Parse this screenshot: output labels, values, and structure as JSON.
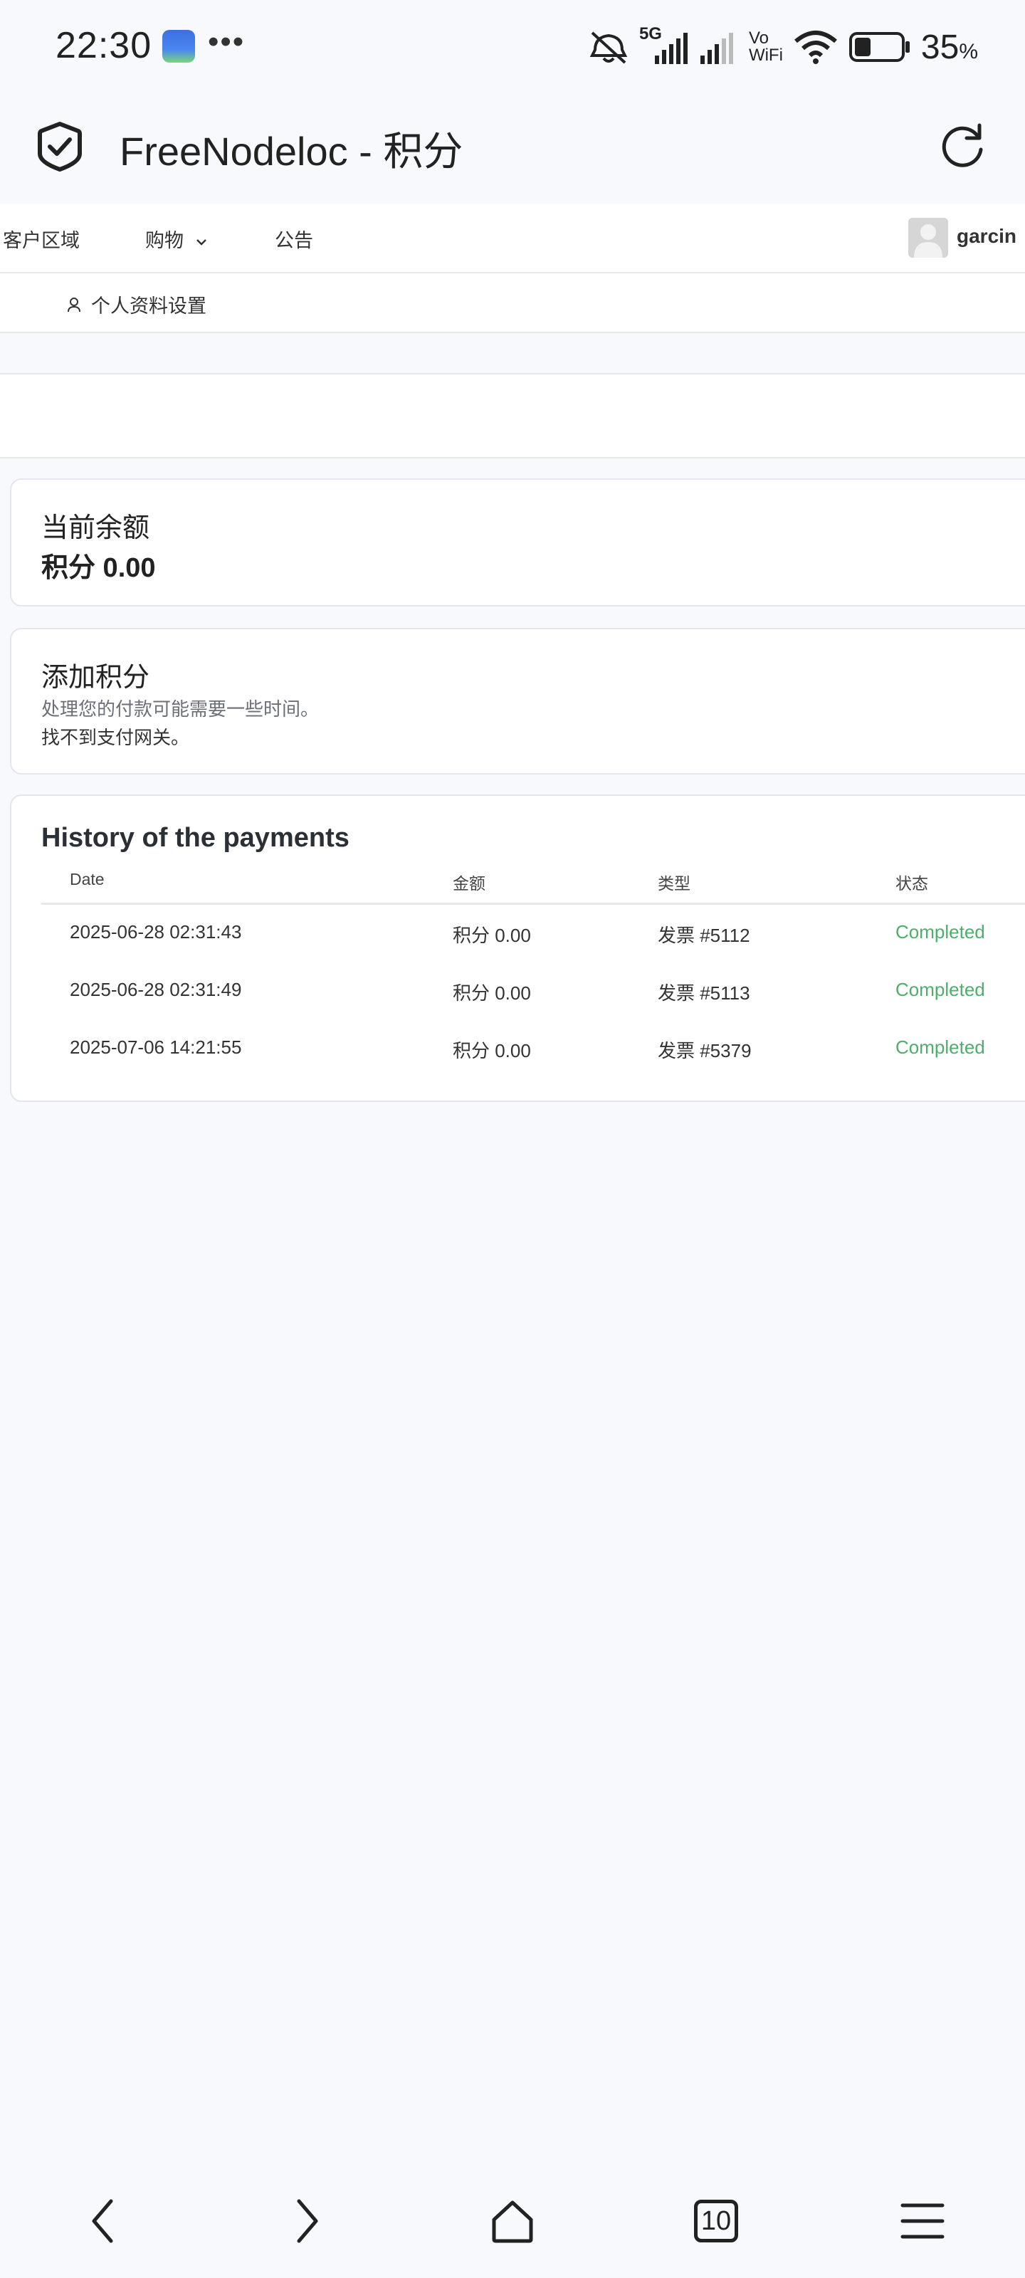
{
  "status_bar": {
    "time": "22:30",
    "more": "•••",
    "net_label": "5G",
    "vowifi_top": "Vo",
    "vowifi_bottom": "WiFi",
    "battery_percent": "35",
    "battery_unit": "%",
    "battery_level": 0.35,
    "icons": [
      "mute-icon",
      "signal-5g-icon",
      "signal-icon",
      "vowifi-icon",
      "wifi-icon",
      "battery-icon"
    ]
  },
  "header": {
    "title": "FreeNodeloc - 积分",
    "icons": [
      "shield-check-icon",
      "refresh-icon"
    ]
  },
  "nav": {
    "items": [
      {
        "label": "客户区域"
      },
      {
        "label": "购物"
      },
      {
        "label": "公告"
      }
    ],
    "username": "garcin"
  },
  "sub_nav": {
    "profile_label": "个人资料设置"
  },
  "balance": {
    "heading": "当前余额",
    "value": "积分 0.00"
  },
  "add_credit": {
    "heading": "添加积分",
    "note": "处理您的付款可能需要一些时间。",
    "gateway_msg": "找不到支付网关。"
  },
  "history": {
    "title": "History of the payments",
    "columns": [
      "Date",
      "金额",
      "类型",
      "状态"
    ],
    "rows": [
      {
        "date": "2025-06-28 02:31:43",
        "amount": "积分 0.00",
        "type": "发票 #5112",
        "status": "Completed"
      },
      {
        "date": "2025-06-28 02:31:49",
        "amount": "积分 0.00",
        "type": "发票 #5113",
        "status": "Completed"
      },
      {
        "date": "2025-07-06 14:21:55",
        "amount": "积分 0.00",
        "type": "发票 #5379",
        "status": "Completed"
      }
    ]
  },
  "bottom_nav": {
    "tab_count": "10",
    "icons": [
      "back-icon",
      "forward-icon",
      "home-icon",
      "tabs-icon",
      "menu-icon"
    ]
  },
  "colors": {
    "background": "#f8f9fd",
    "status_completed": "#4caf6a",
    "card_border": "#e3e6ee"
  }
}
